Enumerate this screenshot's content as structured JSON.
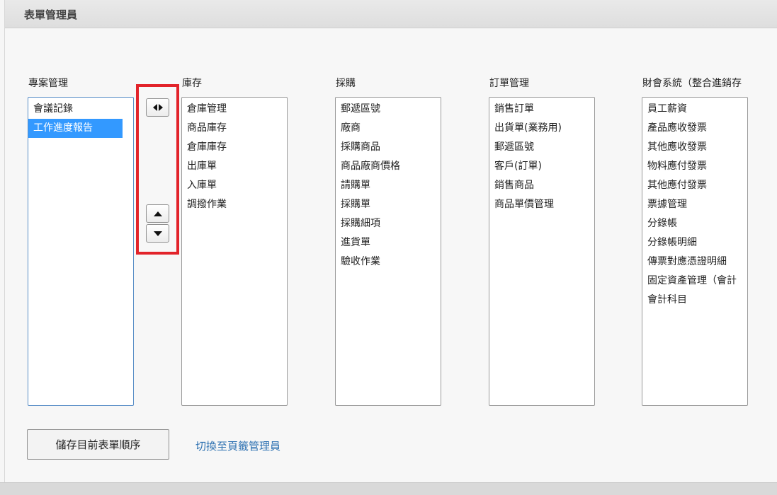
{
  "window": {
    "title": "表單管理員"
  },
  "columns": [
    {
      "title": "專案管理",
      "items": [
        "會議記錄",
        "工作進度報告"
      ],
      "selected_index": 1
    },
    {
      "title": "庫存",
      "items": [
        "倉庫管理",
        "商品庫存",
        "倉庫庫存",
        "出庫單",
        "入庫單",
        "調撥作業"
      ]
    },
    {
      "title": "採購",
      "items": [
        "郵遞區號",
        "廠商",
        "採購商品",
        "商品廠商價格",
        "請購單",
        "採購單",
        "採購細項",
        "進貨單",
        "驗收作業"
      ]
    },
    {
      "title": "訂單管理",
      "items": [
        "銷售訂單",
        "出貨單(業務用)",
        "郵遞區號",
        "客戶(訂單)",
        "銷售商品",
        "商品單價管理"
      ]
    },
    {
      "title": "財會系統（整合進銷存",
      "items": [
        "員工薪資",
        "產品應收發票",
        "其他應收發票",
        "物料應付發票",
        "其他應付發票",
        "票據管理",
        "分錄帳",
        "分錄帳明細",
        "傳票對應憑證明細",
        "固定資產管理（會計",
        "會計科目"
      ]
    }
  ],
  "controls": {
    "move_icon": "left-right-arrows-icon",
    "up_icon": "triangle-up-icon",
    "down_icon": "triangle-down-icon",
    "highlight_color": "#e2232a"
  },
  "footer": {
    "save_label": "儲存目前表單順序",
    "switch_link": "切換至頁籤管理員"
  },
  "colors": {
    "selection": "#3399ff",
    "link": "#2a6fb0"
  }
}
